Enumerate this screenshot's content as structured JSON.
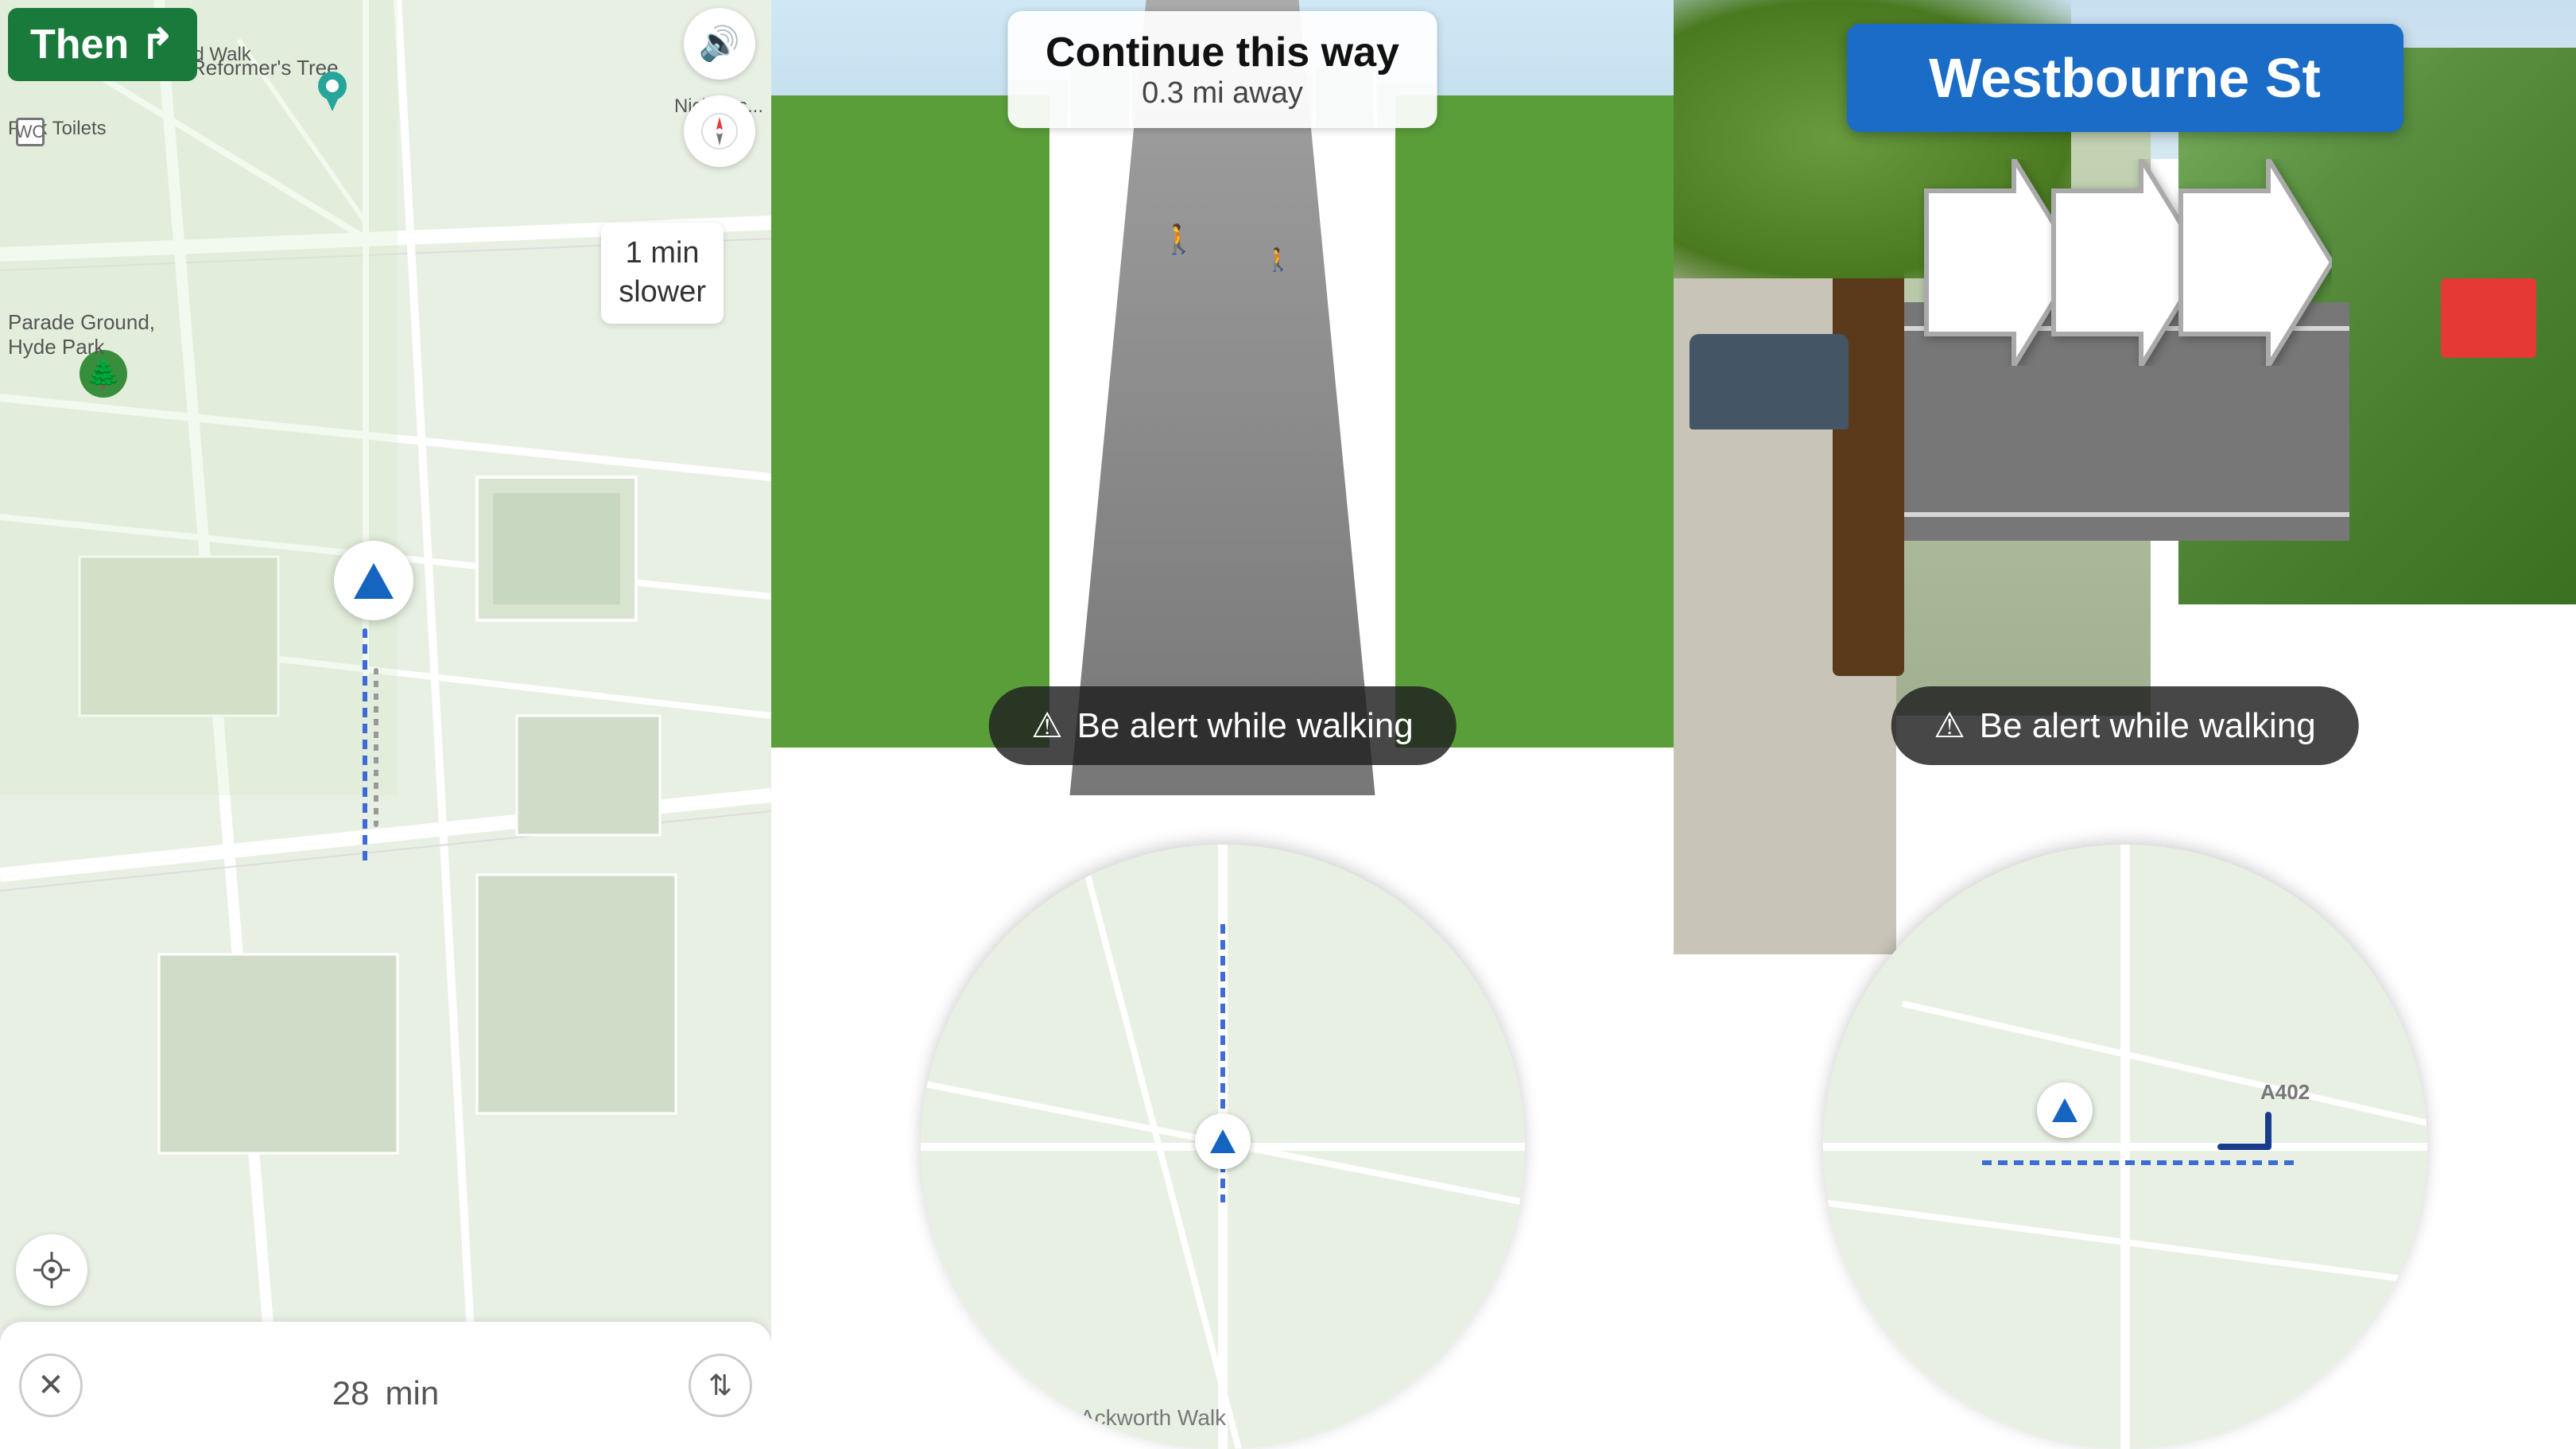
{
  "left": {
    "then_label": "Then",
    "then_icon": "↱",
    "sound_icon": "🔊",
    "compass_icon": "⬆",
    "slower_tooltip_line1": "1 min",
    "slower_tooltip_line2": "slower",
    "location_icon": "⊕",
    "bottom_bar": {
      "close_icon": "✕",
      "time_value": "28",
      "time_unit": "min",
      "route_options_icon": "⇅"
    },
    "map_labels": {
      "reformers_tree": "Reformer's Tree",
      "emma_fitzgerald": "Emma FitzGerald Walk",
      "nicholas": "Nicholas...",
      "parade_ground": "Parade Ground,\nHyde Park",
      "park_toilets": "Park Toilets"
    }
  },
  "center": {
    "continue_title": "Continue this way",
    "continue_sub": "0.3 mi away",
    "alert_text": "Be alert while walking",
    "alert_icon": "⚠"
  },
  "right": {
    "street_name": "Westbourne St",
    "alert_text": "Be alert while walking",
    "alert_icon": "⚠",
    "road_label": "A402"
  }
}
